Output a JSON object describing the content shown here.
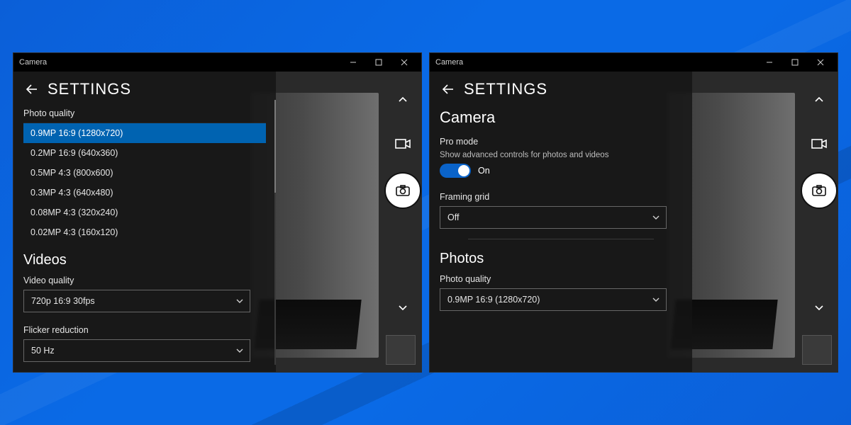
{
  "left": {
    "title": "Camera",
    "header": "SETTINGS",
    "photo_quality_label": "Photo quality",
    "photo_options": [
      "0.9MP 16:9 (1280x720)",
      "0.2MP 16:9 (640x360)",
      "0.5MP 4:3 (800x600)",
      "0.3MP 4:3 (640x480)",
      "0.08MP 4:3 (320x240)",
      "0.02MP 4:3 (160x120)"
    ],
    "videos_header": "Videos",
    "video_quality_label": "Video quality",
    "video_quality_value": "720p 16:9 30fps",
    "flicker_label": "Flicker reduction",
    "flicker_value": "50 Hz"
  },
  "right": {
    "title": "Camera",
    "header": "SETTINGS",
    "camera_header": "Camera",
    "pro_mode_label": "Pro mode",
    "pro_mode_desc": "Show advanced controls for photos and videos",
    "pro_mode_state": "On",
    "framing_label": "Framing grid",
    "framing_value": "Off",
    "photos_header": "Photos",
    "photo_quality_label": "Photo quality",
    "photo_quality_value": "0.9MP 16:9 (1280x720)"
  }
}
